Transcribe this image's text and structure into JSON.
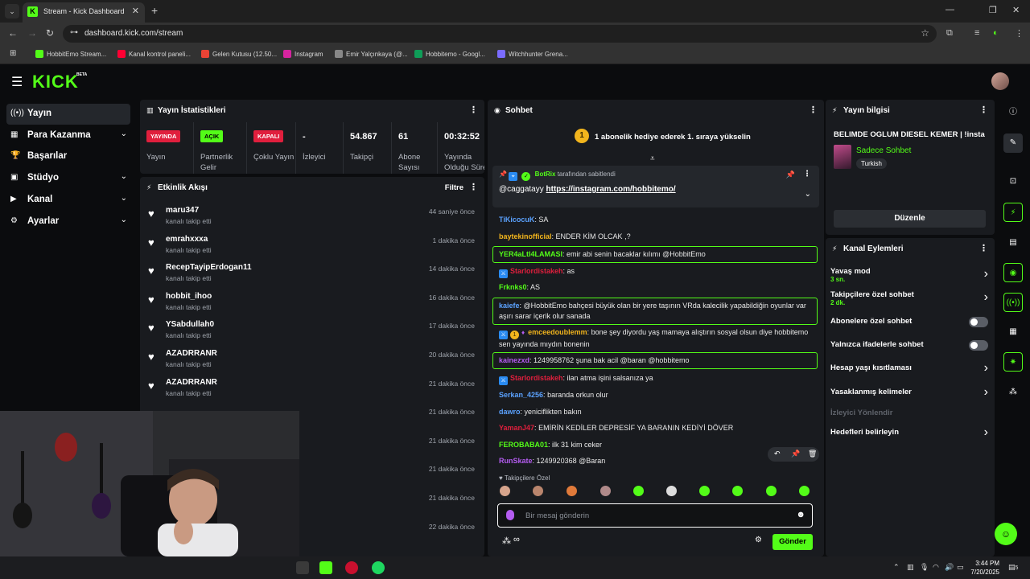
{
  "browser": {
    "tab_title": "Stream - Kick Dashboard",
    "url": "dashboard.kick.com/stream",
    "bookmarks": [
      {
        "label": "HobbitEmo Stream...",
        "color": "#53fc18"
      },
      {
        "label": "Kanal kontrol paneli...",
        "color": "#ff0033"
      },
      {
        "label": "Gelen Kutusu (12.50...",
        "color": "#ea4335"
      },
      {
        "label": "Instagram",
        "color": "#d6249f"
      },
      {
        "label": "Emir Yalçınkaya (@...",
        "color": "#888888"
      },
      {
        "label": "Hobbitemo - Googl...",
        "color": "#0f9d58"
      },
      {
        "label": "Witchhunter Grena...",
        "color": "#7b6cff"
      }
    ]
  },
  "header": {
    "logo": "KICK",
    "beta": "BETA"
  },
  "sidebar": {
    "items": [
      {
        "label": "Yayın",
        "icon": "broadcast-icon",
        "glyph": "((•))",
        "chev": ""
      },
      {
        "label": "Para Kazanma",
        "icon": "money-icon",
        "glyph": "▦",
        "chev": "⌄"
      },
      {
        "label": "Başarılar",
        "icon": "trophy-icon",
        "glyph": "🏆",
        "chev": ""
      },
      {
        "label": "Stüdyo",
        "icon": "studio-icon",
        "glyph": "▣",
        "chev": "⌄"
      },
      {
        "label": "Kanal",
        "icon": "channel-icon",
        "glyph": "▶",
        "chev": "⌄"
      },
      {
        "label": "Ayarlar",
        "icon": "gear-icon",
        "glyph": "⚙",
        "chev": "⌄"
      }
    ]
  },
  "stats": {
    "title": "Yayın İstatistikleri",
    "items": [
      {
        "value": "YAYINDA",
        "label": "Yayın",
        "type": "badge",
        "bg": "#e01f3d",
        "fg": "#ffffff"
      },
      {
        "value": "AÇIK",
        "label": "Partnerlik Gelir",
        "type": "badge",
        "bg": "#53fc18",
        "fg": "#000000"
      },
      {
        "value": "KAPALI",
        "label": "Çoklu Yayın",
        "type": "badge",
        "bg": "#e01f3d",
        "fg": "#ffffff"
      },
      {
        "value": "-",
        "label": "İzleyici",
        "type": "num"
      },
      {
        "value": "54.867",
        "label": "Takipçi",
        "type": "num"
      },
      {
        "value": "61",
        "label": "Abone Sayısı",
        "type": "num"
      },
      {
        "value": "00:32:52",
        "label": "Yayında Olduğu Süre",
        "type": "num"
      }
    ]
  },
  "activity": {
    "title": "Etkinlik Akışı",
    "filter": "Filtre",
    "rows": [
      {
        "name": "maru347",
        "sub": "kanalı takip etti",
        "time": "44 saniye önce"
      },
      {
        "name": "emrahxxxa",
        "sub": "kanalı takip etti",
        "time": "1 dakika önce"
      },
      {
        "name": "RecepTayipErdogan11",
        "sub": "kanalı takip etti",
        "time": "14 dakika önce"
      },
      {
        "name": "hobbit_ihoo",
        "sub": "kanalı takip etti",
        "time": "16 dakika önce"
      },
      {
        "name": "YSabdullah0",
        "sub": "kanalı takip etti",
        "time": "17 dakika önce"
      },
      {
        "name": "AZADRRANR",
        "sub": "kanalı takip etti",
        "time": "20 dakika önce"
      },
      {
        "name": "AZADRRANR",
        "sub": "kanalı takip etti",
        "time": "21 dakika önce"
      },
      {
        "name": "",
        "sub": "",
        "time": "21 dakika önce"
      },
      {
        "name": "",
        "sub": "",
        "time": "21 dakika önce"
      },
      {
        "name": "",
        "sub": "",
        "time": "21 dakika önce"
      },
      {
        "name": "",
        "sub": "",
        "time": "21 dakika önce"
      },
      {
        "name": "",
        "sub": "",
        "time": "22 dakika önce"
      }
    ]
  },
  "chat": {
    "title": "Sohbet",
    "gift_banner": "1 abonelik hediye ederek 1. sıraya yükselin",
    "gift_coin": "1",
    "pinned": {
      "by": "BotRix",
      "by_suffix": "tarafından sabitlendi",
      "mention": "@caggatayy",
      "link": "https://instagram.com/hobbitemo/"
    },
    "messages": [
      {
        "user": "TiKicocuK",
        "color": "#5ba2ff",
        "text": "SA",
        "hl": false,
        "badges": ""
      },
      {
        "user": "baytekinofficial",
        "color": "#f2b51d",
        "text": "ENDER KİM OLCAK ,?",
        "hl": false,
        "badges": ""
      },
      {
        "user": "YER4aLtI4LAMASI",
        "color": "#53fc18",
        "text": "emir abi senin bacaklar kılımı @HobbitEmo",
        "hl": true,
        "badges": ""
      },
      {
        "user": "Starlordistakeh",
        "color": "#e01f3d",
        "text": "as",
        "hl": false,
        "badges": "mod"
      },
      {
        "user": "Frknks0",
        "color": "#53fc18",
        "text": "AS",
        "hl": false,
        "badges": ""
      },
      {
        "user": "kaiefe",
        "color": "#5ba2ff",
        "text": "@HobbitEmo bahçesi büyük olan bir yere taşının VRda kalecilik yapabildiğin oyunlar var aşırı sarar içerik olur sanada",
        "hl": true,
        "badges": ""
      },
      {
        "user": "emceedoublemm",
        "color": "#f2b51d",
        "text": "bone şey diyordu yaş mamaya alıştırın sosyal olsun diye hobbitemo sen yayında mıydın bonenin",
        "hl": false,
        "badges": "mod-sub"
      },
      {
        "user": "kainezxd",
        "color": "#b45cf0",
        "text": "1249958762 şuna bak acil @baran @hobbitemo",
        "hl": true,
        "badges": ""
      },
      {
        "user": "Starlordistakeh",
        "color": "#e01f3d",
        "text": "ilan atma işini salsanıza ya",
        "hl": false,
        "badges": "mod"
      },
      {
        "user": "Serkan_4256",
        "color": "#5ba2ff",
        "text": "baranda orkun olur",
        "hl": false,
        "badges": ""
      },
      {
        "user": "dawro",
        "color": "#5ba2ff",
        "text": "yeniciflikten bakın",
        "hl": false,
        "badges": ""
      },
      {
        "user": "YamanJ47",
        "color": "#e01f3d",
        "text": "EMİRİN KEDİLER DEPRESİF YA BARANIN KEDİYİ DÖVER",
        "hl": false,
        "badges": ""
      },
      {
        "user": "FEROBABA01",
        "color": "#53fc18",
        "text": "ilk 31 kim ceker",
        "hl": false,
        "badges": ""
      },
      {
        "user": "RunSkate",
        "color": "#b45cf0",
        "text": "1249920368 @Baran",
        "hl": false,
        "badges": ""
      }
    ],
    "emote_label": "Takipçilere Özel",
    "input_placeholder": "Bir mesaj gönderin",
    "send": "Gönder",
    "footer_glyph": "∞"
  },
  "stream_info": {
    "title": "Yayın bilgisi",
    "stream_title": "BELIMDE OGLUM DIESEL KEMER | !insta",
    "category": "Sadece Sohbet",
    "language": "Turkish",
    "edit": "Düzenle"
  },
  "channel_actions": {
    "title": "Kanal Eylemleri",
    "rows": [
      {
        "label": "Yavaş mod",
        "sub": "3 sn.",
        "kind": "chev"
      },
      {
        "label": "Takipçilere özel sohbet",
        "sub": "2 dk.",
        "kind": "chev"
      },
      {
        "label": "Abonelere özel sohbet",
        "sub": "",
        "kind": "toggle"
      },
      {
        "label": "Yalnızca ifadelerle sohbet",
        "sub": "",
        "kind": "toggle"
      },
      {
        "label": "Hesap yaşı kısıtlaması",
        "sub": "",
        "kind": "chev"
      },
      {
        "label": "Yasaklanmış kelimeler",
        "sub": "",
        "kind": "chev"
      },
      {
        "label": "İzleyici Yönlendir",
        "sub": "",
        "kind": "disabled"
      },
      {
        "label": "Hedefleri belirleyin",
        "sub": "",
        "kind": "chev"
      }
    ]
  },
  "taskbar": {
    "time": "3:44 PM",
    "date": "7/20/2025",
    "notif": "5"
  },
  "colors": {
    "accent": "#53fc18",
    "live": "#e01f3d",
    "panel": "#191b1f",
    "bg": "#0b0c0e"
  }
}
